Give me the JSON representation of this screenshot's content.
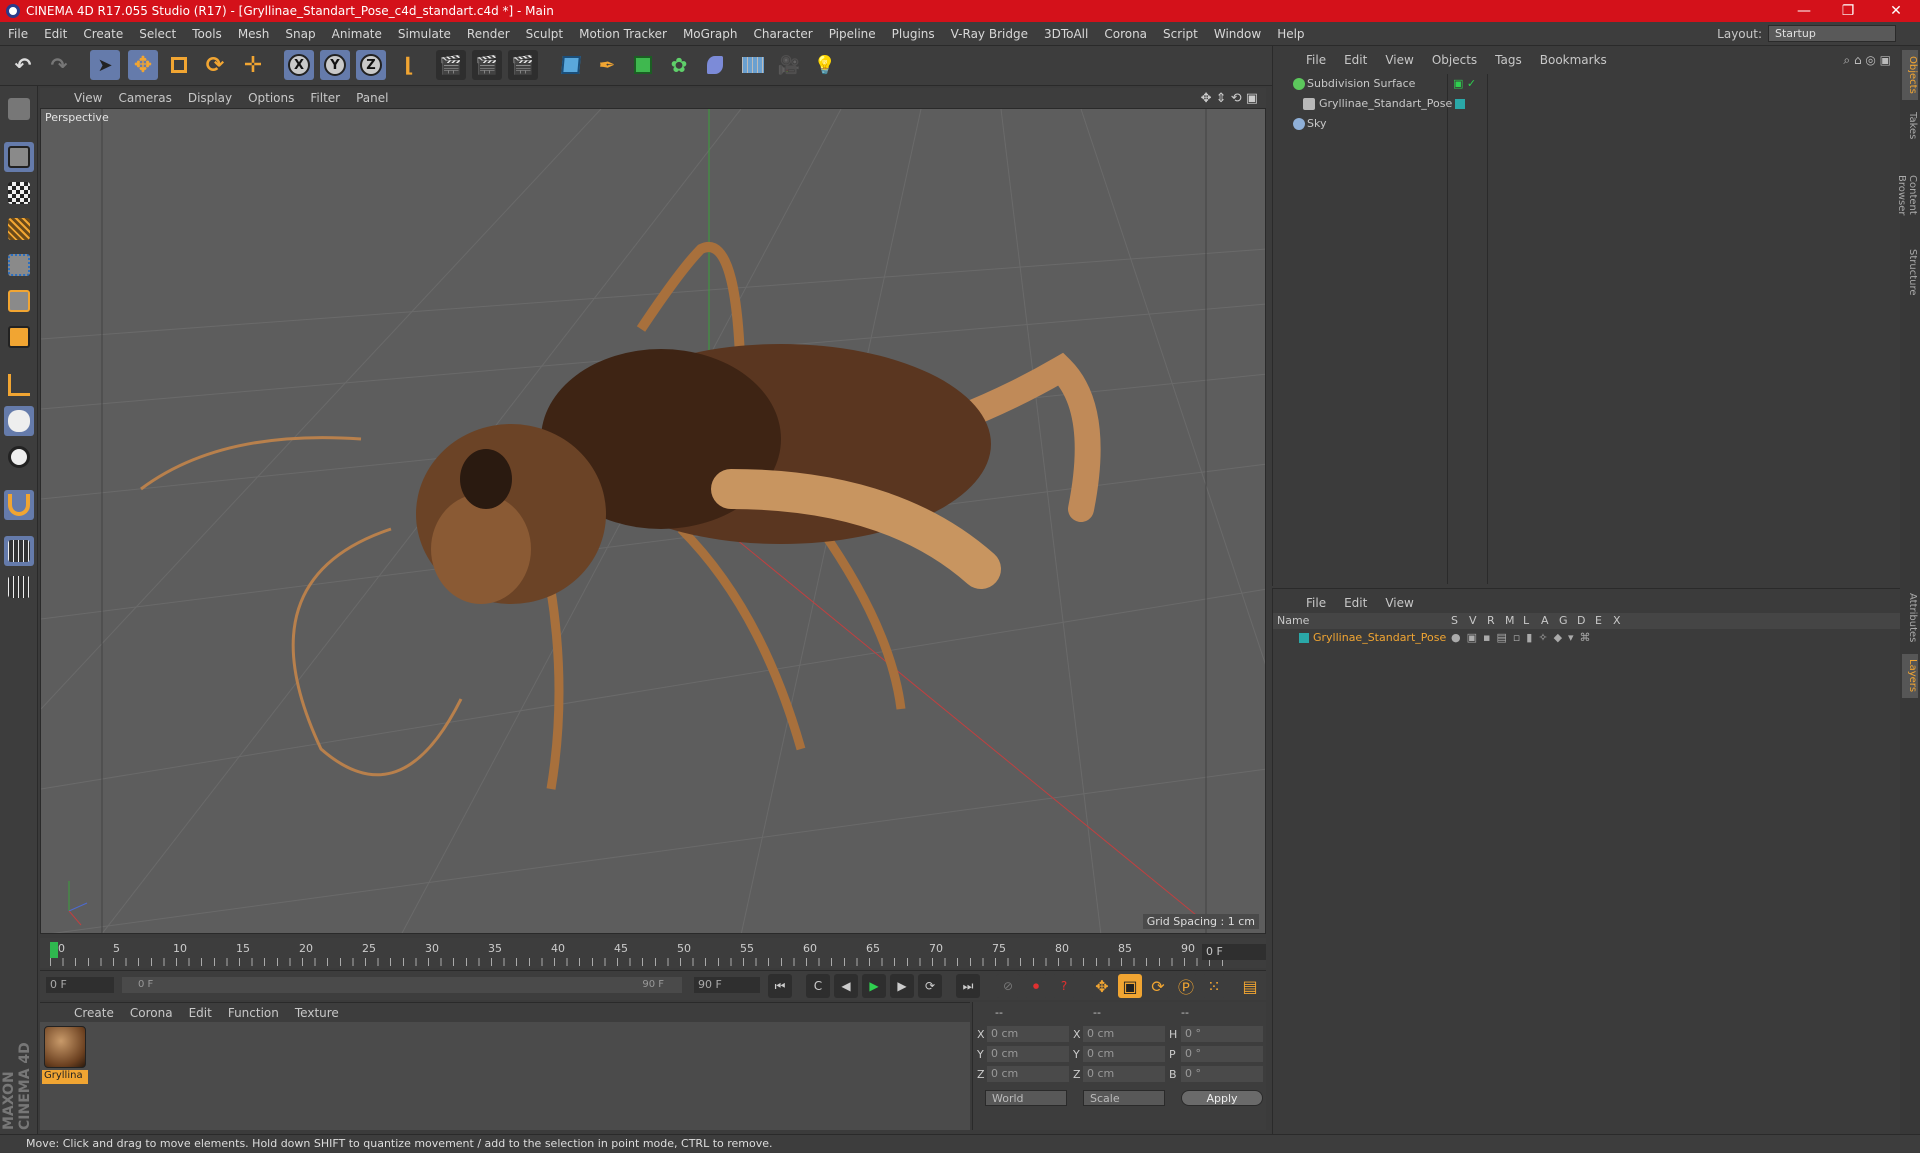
{
  "window": {
    "title": "CINEMA 4D R17.055 Studio (R17) - [Gryllinae_Standart_Pose_c4d_standart.c4d *] - Main",
    "controls": [
      "—",
      "❐",
      "✕"
    ]
  },
  "menu": [
    "File",
    "Edit",
    "Create",
    "Select",
    "Tools",
    "Mesh",
    "Snap",
    "Animate",
    "Simulate",
    "Render",
    "Sculpt",
    "Motion Tracker",
    "MoGraph",
    "Character",
    "Pipeline",
    "Plugins",
    "V-Ray Bridge",
    "3DToAll",
    "Corona",
    "Script",
    "Window",
    "Help"
  ],
  "layout": {
    "label": "Layout:",
    "value": "Startup"
  },
  "toolbar": {
    "axis_x": "X",
    "axis_y": "Y",
    "axis_z": "Z"
  },
  "viewport": {
    "menu": [
      "View",
      "Cameras",
      "Display",
      "Options",
      "Filter",
      "Panel"
    ],
    "label": "Perspective",
    "grid_spacing": "Grid Spacing : 1 cm"
  },
  "timeline": {
    "ticks": [
      "0",
      "5",
      "10",
      "15",
      "20",
      "25",
      "30",
      "35",
      "40",
      "45",
      "50",
      "55",
      "60",
      "65",
      "70",
      "75",
      "80",
      "85",
      "90"
    ],
    "current_frame": "0 F",
    "start_field": "0 F",
    "range_start": "0 F",
    "range_end": "90 F",
    "end_field": "90 F"
  },
  "material_manager": {
    "menu": [
      "Create",
      "Corona",
      "Edit",
      "Function",
      "Texture"
    ],
    "material_name": "Gryllina"
  },
  "coordinates": {
    "header": [
      "--",
      "--",
      "--"
    ],
    "rows": [
      {
        "l1": "X",
        "v1": "0 cm",
        "l2": "X",
        "v2": "0 cm",
        "l3": "H",
        "v3": "0 °"
      },
      {
        "l1": "Y",
        "v1": "0 cm",
        "l2": "Y",
        "v2": "0 cm",
        "l3": "P",
        "v3": "0 °"
      },
      {
        "l1": "Z",
        "v1": "0 cm",
        "l2": "Z",
        "v2": "0 cm",
        "l3": "B",
        "v3": "0 °"
      }
    ],
    "mode_world": "World",
    "mode_scale": "Scale",
    "apply": "Apply"
  },
  "object_manager": {
    "menu": [
      "File",
      "Edit",
      "View",
      "Objects",
      "Tags",
      "Bookmarks"
    ],
    "objects": [
      {
        "name": "Subdivision Surface",
        "color": "#5cc85c"
      },
      {
        "name": "Gryllinae_Standart_Pose",
        "color": "#b8b8b8"
      },
      {
        "name": "Sky",
        "color": "#8fb0d8"
      }
    ]
  },
  "layer_manager": {
    "menu": [
      "File",
      "Edit",
      "View"
    ],
    "columns": [
      "Name",
      "S",
      "V",
      "R",
      "M",
      "L",
      "A",
      "G",
      "D",
      "E",
      "X"
    ],
    "layer_name": "Gryllinae_Standart_Pose",
    "layer_color": "#2aa8a8"
  },
  "right_tabs": [
    "Objects",
    "Takes",
    "Content Browser",
    "Structure",
    "Attributes",
    "Layers"
  ],
  "status": "Move: Click and drag to move elements. Hold down SHIFT to quantize movement / add to the selection in point mode, CTRL to remove.",
  "branding": "MAXON CINEMA 4D",
  "colors": {
    "accent": "#f1a532",
    "title_bar": "#d4111a",
    "selected_tool": "#657bab"
  }
}
